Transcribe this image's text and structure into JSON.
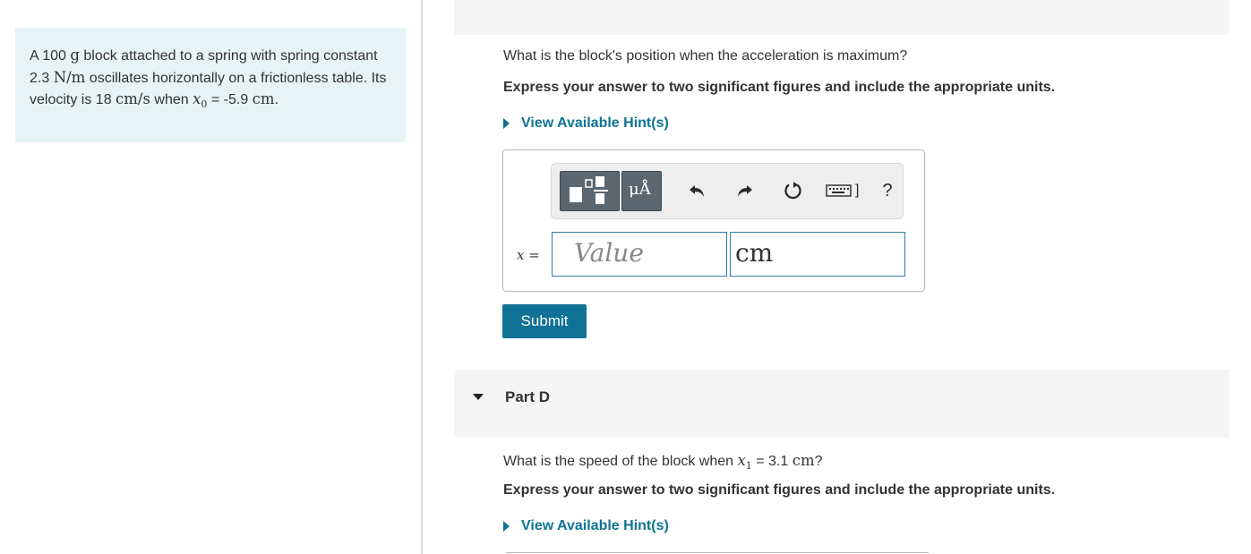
{
  "problem": {
    "text_1": "A 100 ",
    "mass_unit": "g",
    "text_2": " block attached to a spring with spring constant 2.3 ",
    "k_unit": "N/m",
    "text_3": " oscillates horizontally on a frictionless table. Its velocity is 18 ",
    "v_unit": "cm/s",
    "text_4": " when ",
    "x0_symbol": "x",
    "x0_sub": "0",
    "text_5": " = -5.9 ",
    "x0_unit": "cm",
    "text_6": "."
  },
  "part_c": {
    "question": "What is the block's position when the acceleration is maximum?",
    "instruction": "Express your answer to two significant figures and include the appropriate units.",
    "hint_label": "View Available Hint(s)",
    "variable_label": "x =",
    "value_placeholder": "Value",
    "unit_value": "cm",
    "submit_label": "Submit",
    "toolbar": {
      "units_label": "μÅ",
      "keyboard_label": "]",
      "help_label": "?"
    }
  },
  "part_d": {
    "title": "Part D",
    "question_1": "What is the speed of the block when ",
    "x1_symbol": "x",
    "x1_sub": "1",
    "question_2": " = 3.1 ",
    "unit": "cm",
    "question_3": "?",
    "instruction": "Express your answer to two significant figures and include the appropriate units.",
    "hint_label": "View Available Hint(s)"
  },
  "colors": {
    "problem_bg": "#e6f4f5",
    "accent": "#0f7294",
    "band_bg": "#f5f5f5"
  }
}
